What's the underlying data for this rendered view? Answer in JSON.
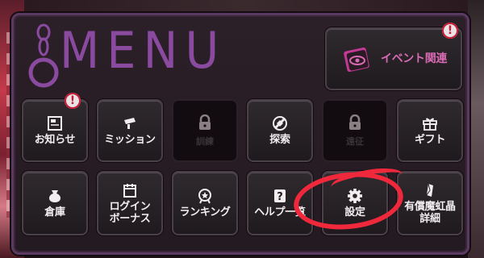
{
  "header": {
    "logo_text": "MENU"
  },
  "event_button": {
    "label": "イベント関連",
    "icon": "event-eye-icon",
    "badge": "!"
  },
  "row1": [
    {
      "label": "お知らせ",
      "icon": "notice-icon",
      "badge": "!",
      "locked": false
    },
    {
      "label": "ミッション",
      "icon": "scroll-icon",
      "locked": false
    },
    {
      "label": "",
      "icon": "lock-icon",
      "ghost": "訓練",
      "locked": true
    },
    {
      "label": "探索",
      "icon": "explore-icon",
      "locked": false
    },
    {
      "label": "",
      "icon": "lock-icon",
      "ghost": "遠征",
      "locked": true
    },
    {
      "label": "ギフト",
      "icon": "gift-icon",
      "locked": false
    }
  ],
  "row2": [
    {
      "label": "倉庫",
      "icon": "bag-icon"
    },
    {
      "label_line1": "ログイン",
      "label_line2": "ボーナス",
      "icon": "calendar-icon"
    },
    {
      "label": "ランキング",
      "icon": "medal-icon"
    },
    {
      "label": "ヘルプ一覧",
      "icon": "help-icon"
    },
    {
      "label": "設定",
      "icon": "gear-icon"
    },
    {
      "label_line1": "有償魔虹晶",
      "label_line2": "詳細",
      "icon": "crystal-icon"
    }
  ],
  "colors": {
    "accent": "#8a4aa0",
    "event_text": "#d86ab4",
    "badge_red": "#c81a34",
    "annotation": "#f0283c"
  }
}
